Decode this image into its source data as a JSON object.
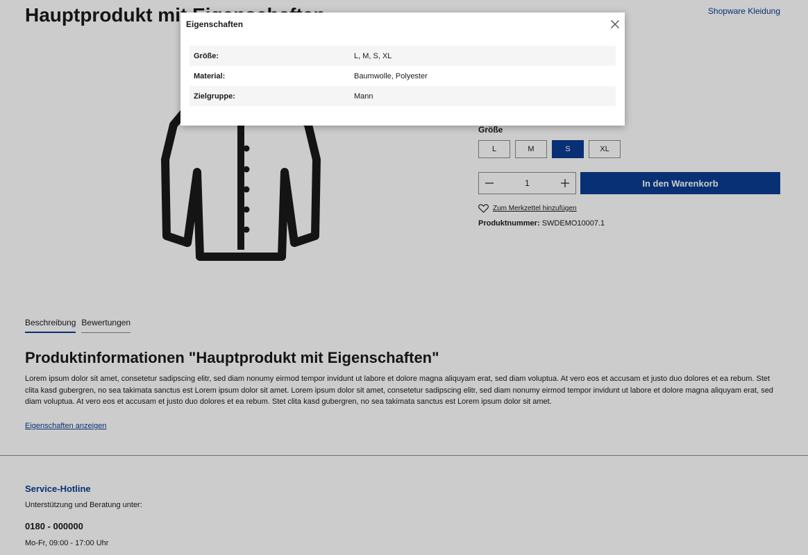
{
  "page": {
    "title": "Hauptprodukt mit Eigenschaften",
    "brand_link": "Shopware Kleidung"
  },
  "buy_box": {
    "size_label": "Größe",
    "sizes": [
      "L",
      "M",
      "S",
      "XL"
    ],
    "selected_size": "S",
    "quantity": "1",
    "add_to_cart": "In den Warenkorb",
    "wishlist": "Zum Merkzettel hinzufügen",
    "product_number_label": "Produktnummer:",
    "product_number": "SWDEMO10007.1"
  },
  "tabs": [
    "Beschreibung",
    "Bewertungen"
  ],
  "description": {
    "title": "Produktinformationen \"Hauptprodukt mit Eigenschaften\"",
    "text": "Lorem ipsum dolor sit amet, consetetur sadipscing elitr, sed diam nonumy eirmod tempor invidunt ut labore et dolore magna aliquyam erat, sed diam voluptua. At vero eos et accusam et justo duo dolores et ea rebum. Stet clita kasd gubergren, no sea takimata sanctus est Lorem ipsum dolor sit amet. Lorem ipsum dolor sit amet, consetetur sadipscing elitr, sed diam nonumy eirmod tempor invidunt ut labore et dolore magna aliquyam erat, sed diam voluptua. At vero eos et accusam et justo duo dolores et ea rebum. Stet clita kasd gubergren, no sea takimata sanctus est Lorem ipsum dolor sit amet.",
    "show_properties": "Eigenschaften anzeigen"
  },
  "footer": {
    "hotline_title": "Service-Hotline",
    "hotline_sub": "Unterstützung und Beratung unter:",
    "hotline_phone": "0180 - 000000",
    "hotline_hours": "Mo-Fr, 09:00 - 17:00 Uhr"
  },
  "modal": {
    "title": "Eigenschaften",
    "properties": [
      {
        "key": "Größe:",
        "value": "L, M, S, XL"
      },
      {
        "key": "Material:",
        "value": "Baumwolle, Polyester"
      },
      {
        "key": "Zielgruppe:",
        "value": "Mann"
      }
    ]
  },
  "colors": {
    "accent": "#0b3d91",
    "overlay": "rgba(0,0,0,0.2)"
  },
  "icons": {
    "close": "close-icon",
    "wishlist": "heart-icon",
    "minus": "minus-icon",
    "plus": "plus-icon"
  }
}
